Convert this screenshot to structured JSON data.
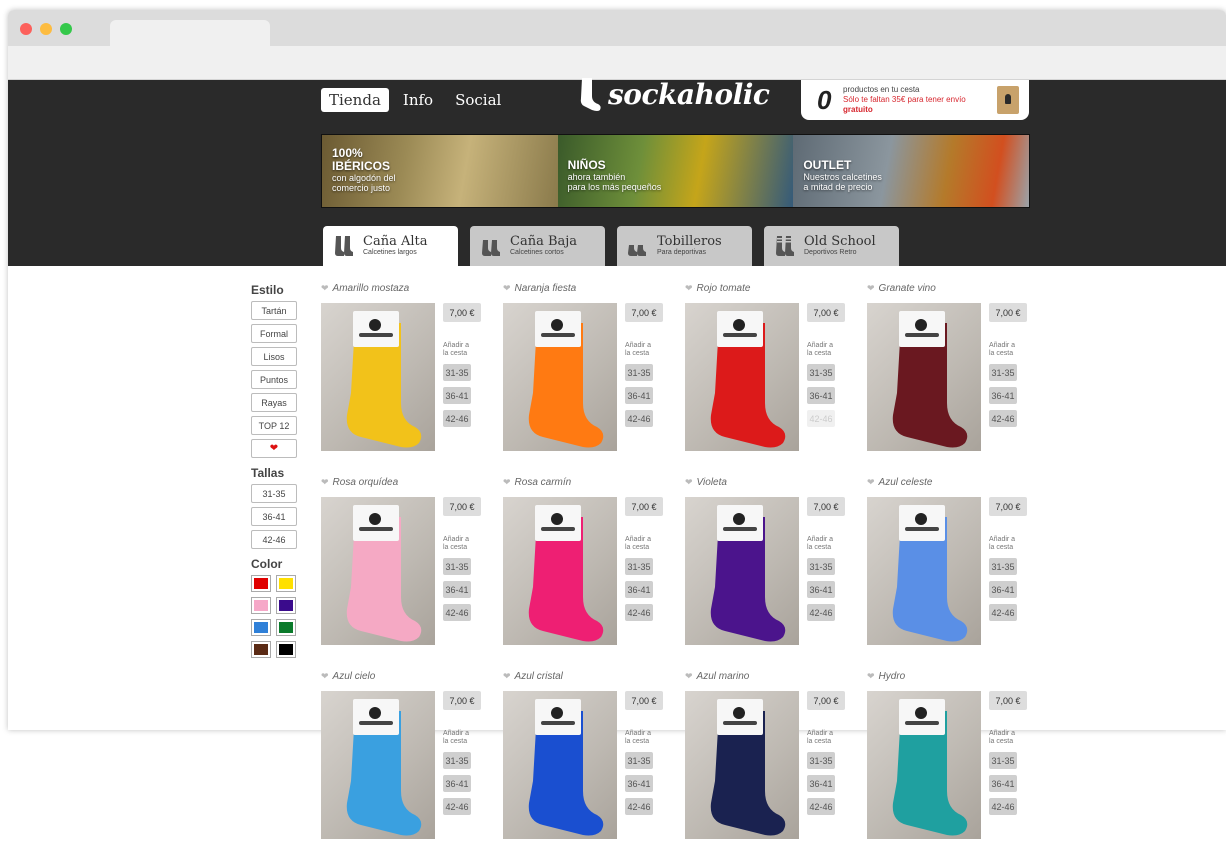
{
  "nav": [
    {
      "label": "Tienda",
      "active": true
    },
    {
      "label": "Info",
      "active": false
    },
    {
      "label": "Social",
      "active": false
    }
  ],
  "logo": {
    "text": "sockaholic"
  },
  "cart": {
    "count": "0",
    "line1": "productos en tu cesta",
    "line2": "Sólo te faltan 35€ para tener envío",
    "line3": "gratuito"
  },
  "banners": [
    {
      "title": "100%\nIBÉRICOS",
      "sub": "con algodón del\ncomercio justo"
    },
    {
      "title": "NIÑOS",
      "sub": "ahora también\npara los más pequeños"
    },
    {
      "title": "OUTLET",
      "sub": "Nuestros calcetines\na mitad de precio"
    }
  ],
  "categories": [
    {
      "title": "Caña Alta",
      "sub": "Calcetines largos",
      "active": true
    },
    {
      "title": "Caña Baja",
      "sub": "Calcetines cortos",
      "active": false
    },
    {
      "title": "Tobilleros",
      "sub": "Para deportivas",
      "active": false
    },
    {
      "title": "Old School",
      "sub": "Deportivos Retro",
      "active": false
    }
  ],
  "sidebar": {
    "style_heading": "Estilo",
    "styles": [
      "Tartán",
      "Formal",
      "Lisos",
      "Puntos",
      "Rayas",
      "TOP 12"
    ],
    "favorites_icon": "heart-icon",
    "sizes_heading": "Tallas",
    "sizes": [
      "31-35",
      "36-41",
      "42-46"
    ],
    "color_heading": "Color",
    "colors": [
      "#e00000",
      "#ffe000",
      "#f6a8c8",
      "#3a0b8c",
      "#2f80d8",
      "#0a7a2a",
      "#5a2a14",
      "#000000"
    ]
  },
  "common": {
    "price": "7,00 €",
    "add_line1": "Añadir a",
    "add_line2": "la cesta",
    "sizes": [
      "31-35",
      "36-41",
      "42-46"
    ]
  },
  "products": [
    {
      "name": "Amarillo mostaza",
      "color": "#f2c21a",
      "dim_last": false
    },
    {
      "name": "Naranja fiesta",
      "color": "#ff7a12",
      "dim_last": false
    },
    {
      "name": "Rojo tomate",
      "color": "#dc1a1a",
      "dim_last": true
    },
    {
      "name": "Granate vino",
      "color": "#6a1820",
      "dim_last": false
    },
    {
      "name": "Rosa orquídea",
      "color": "#f5a9c4",
      "dim_last": false
    },
    {
      "name": "Rosa carmín",
      "color": "#ee1f73",
      "dim_last": false
    },
    {
      "name": "Violeta",
      "color": "#4b148c",
      "dim_last": false
    },
    {
      "name": "Azul celeste",
      "color": "#5a8fe6",
      "dim_last": false
    },
    {
      "name": "Azul cielo",
      "color": "#3aa0e0",
      "dim_last": false
    },
    {
      "name": "Azul cristal",
      "color": "#1a4fd0",
      "dim_last": false
    },
    {
      "name": "Azul marino",
      "color": "#1a2250",
      "dim_last": false
    },
    {
      "name": "Hydro",
      "color": "#1fa0a0",
      "dim_last": false
    }
  ]
}
